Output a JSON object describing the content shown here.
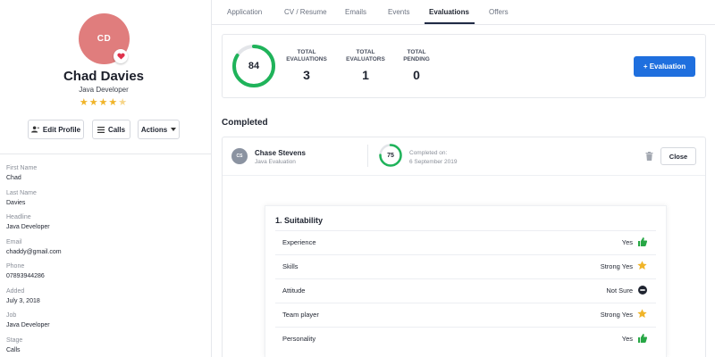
{
  "profile": {
    "initials": "CD",
    "name": "Chad Davies",
    "role": "Java Developer",
    "rating": 4.5,
    "rating_stars": "★★★★",
    "rating_half_star": "★",
    "heart_icon": "heart-icon"
  },
  "actions": {
    "edit_profile": "Edit Profile",
    "calls": "Calls",
    "actions": "Actions"
  },
  "fields": [
    {
      "label": "First Name",
      "value": "Chad"
    },
    {
      "label": "Last Name",
      "value": "Davies"
    },
    {
      "label": "Headline",
      "value": "Java Developer"
    },
    {
      "label": "Email",
      "value": "chaddy@gmail.com"
    },
    {
      "label": "Phone",
      "value": "07893944286"
    },
    {
      "label": "Added",
      "value": "July 3, 2018"
    },
    {
      "label": "Job",
      "value": "Java Developer"
    },
    {
      "label": "Stage",
      "value": "Calls"
    }
  ],
  "tabs": [
    {
      "label": "Application"
    },
    {
      "label": "CV / Resume"
    },
    {
      "label": "Emails"
    },
    {
      "label": "Events"
    },
    {
      "label": "Evaluations"
    },
    {
      "label": "Offers"
    }
  ],
  "active_tab": "Evaluations",
  "summary": {
    "score": "84",
    "score_fraction": 0.84,
    "total_evaluations_label": "TOTAL\nEVALUATIONS",
    "total_evaluations": "3",
    "total_evaluators_label": "TOTAL\nEVALUATORS",
    "total_evaluators": "1",
    "total_pending_label": "TOTAL\nPENDING",
    "total_pending": "0",
    "add_button": "+ Evaluation"
  },
  "completed_title": "Completed",
  "evaluation": {
    "initials": "CS",
    "evaluator": "Chase Stevens",
    "type": "Java Evaluation",
    "score": "75",
    "score_fraction": 0.75,
    "completed_label": "Completed on:",
    "completed_date": "6 September 2019",
    "close": "Close"
  },
  "suitability": {
    "title": "1. Suitability",
    "criteria": [
      {
        "name": "Experience",
        "value": "Yes",
        "icon": "thumbs-up-icon"
      },
      {
        "name": "Skills",
        "value": "Strong Yes",
        "icon": "star-icon"
      },
      {
        "name": "Attitude",
        "value": "Not Sure",
        "icon": "minus-circle-icon"
      },
      {
        "name": "Team player",
        "value": "Strong Yes",
        "icon": "star-icon"
      },
      {
        "name": "Personality",
        "value": "Yes",
        "icon": "thumbs-up-icon"
      }
    ]
  },
  "colors": {
    "ring_green": "#1fb35a",
    "ring_track": "#e3e5e9",
    "primary_button": "#1f6fde",
    "avatar": "#e07d7d",
    "thumbs_green": "#27a745",
    "star_yellow": "#f0b429"
  }
}
